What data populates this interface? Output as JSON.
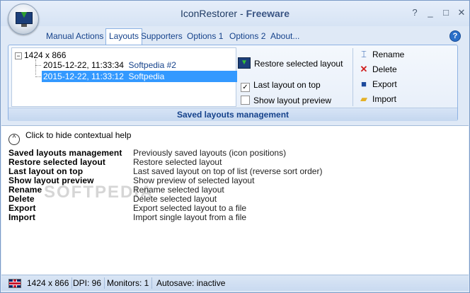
{
  "window": {
    "app_name": "IconRestorer",
    "separator": " - ",
    "edition": "Freeware",
    "controls": [
      "?",
      "_",
      "□",
      "✕"
    ]
  },
  "tabs": [
    {
      "label": "Manual Actions",
      "active": false
    },
    {
      "label": "Layouts",
      "active": true
    },
    {
      "label": "Supporters",
      "active": false
    },
    {
      "label": "Options 1",
      "active": false
    },
    {
      "label": "Options 2",
      "active": false
    },
    {
      "label": "About...",
      "active": false
    }
  ],
  "help_button": "?",
  "tree": {
    "expander": "−",
    "root": "1424 x 866",
    "children": [
      {
        "date": "2015-12-22, 11:33:34",
        "name": "Softpedia #2",
        "selected": false
      },
      {
        "date": "2015-12-22, 11:33:12",
        "name": "Softpedia",
        "selected": true
      }
    ]
  },
  "actions": {
    "restore": "Restore selected layout",
    "last_on_top": {
      "label": "Last layout on top",
      "checked": true
    },
    "show_preview": {
      "label": "Show layout preview",
      "checked": false
    }
  },
  "right_actions": [
    {
      "label": "Rename",
      "icon": "rename-icon"
    },
    {
      "label": "Delete",
      "icon": "delete-icon"
    },
    {
      "label": "Export",
      "icon": "save-icon"
    },
    {
      "label": "Import",
      "icon": "folder-icon"
    }
  ],
  "group_label": "Saved layouts management",
  "help": {
    "toggle_glyph": "^",
    "toggle": "Click to hide contextual help",
    "watermark": "SOFTPEDIA",
    "rows": [
      {
        "term": "Saved layouts management",
        "desc": "Previously saved layouts (icon positions)"
      },
      {
        "term": "Restore selected layout",
        "desc": "Restore selected layout"
      },
      {
        "term": "Last layout on top",
        "desc": "Last saved layout on top of list (reverse sort order)"
      },
      {
        "term": "Show layout preview",
        "desc": "Show preview of selected layout"
      },
      {
        "term": "Rename",
        "desc": "Rename selected layout"
      },
      {
        "term": "Delete",
        "desc": "Delete selected layout"
      },
      {
        "term": "Export",
        "desc": "Export selected layout to a file"
      },
      {
        "term": "Import",
        "desc": "Import single layout from a file"
      }
    ]
  },
  "status": {
    "resolution": "1424 x 866",
    "dpi": "DPI: 96",
    "monitors": "Monitors: 1",
    "autosave": "Autosave: inactive"
  }
}
